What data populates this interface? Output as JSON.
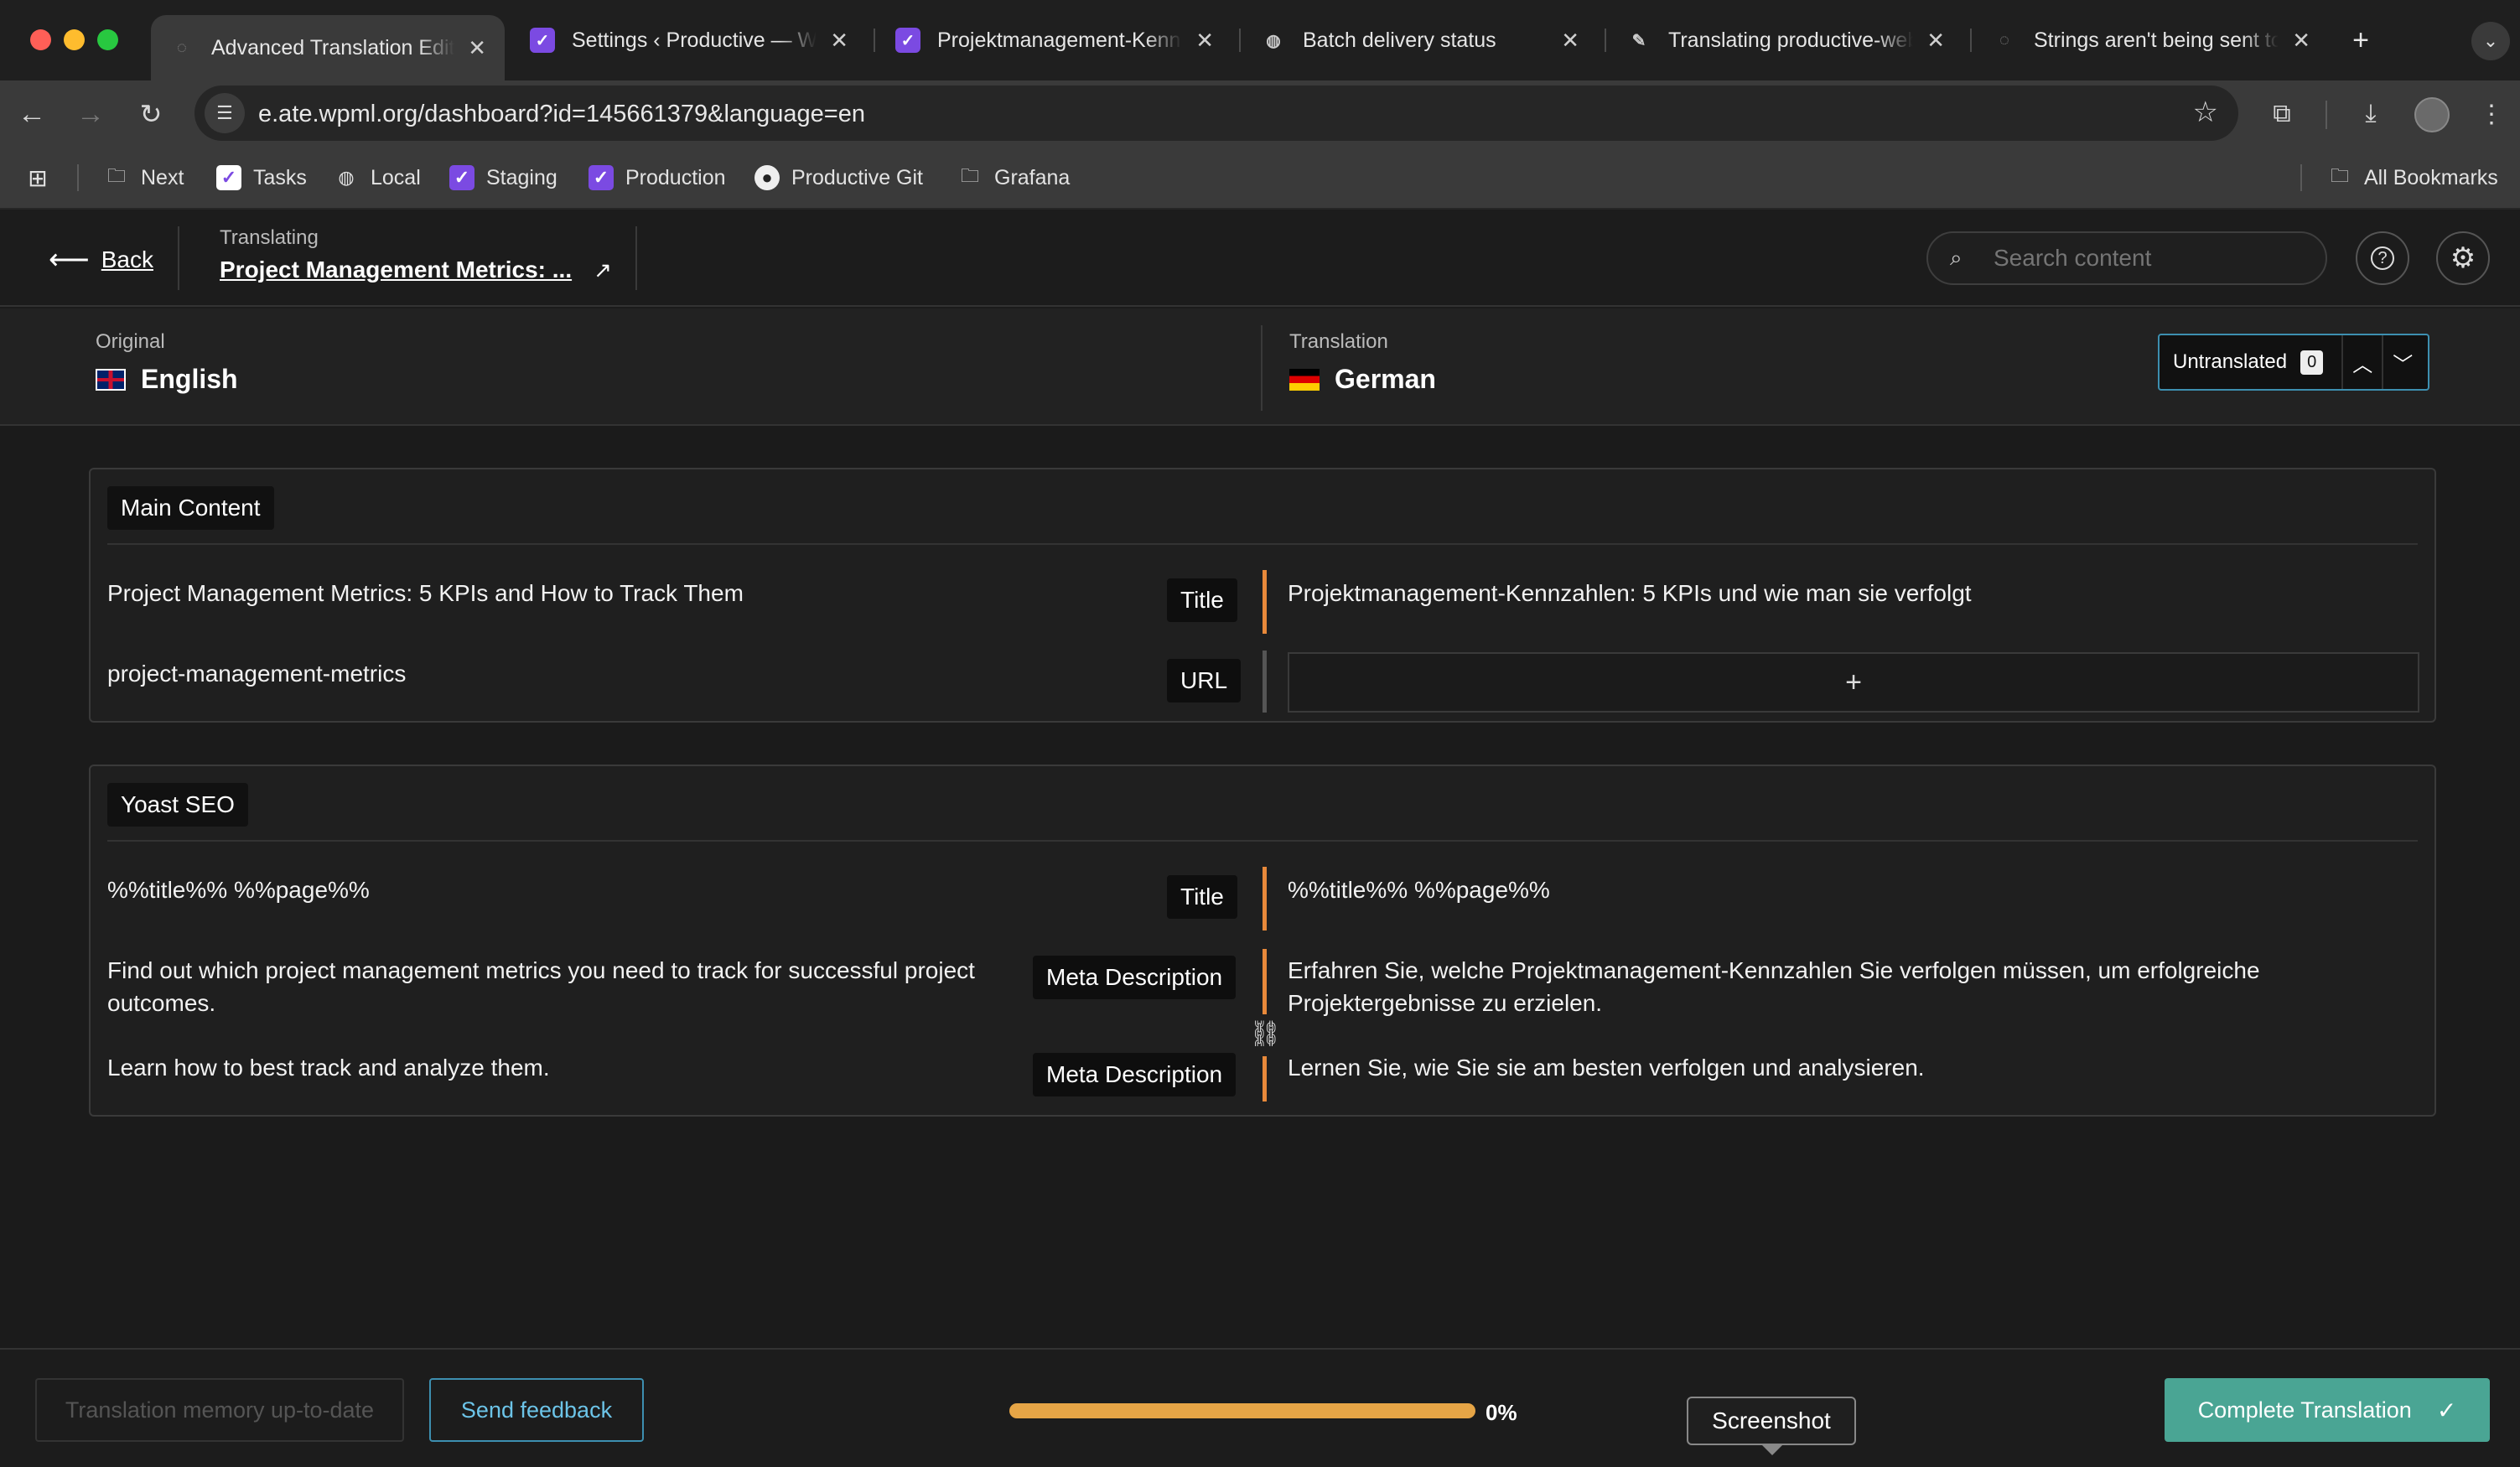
{
  "browser": {
    "tabs": [
      {
        "title": "Advanced Translation Editor",
        "icon": "loading-icon",
        "active": true
      },
      {
        "title": "Settings ‹ Productive — WordPress",
        "icon": "productive-icon",
        "active": false
      },
      {
        "title": "Projektmanagement-Kennzahlen",
        "icon": "productive-icon",
        "active": false
      },
      {
        "title": "Batch delivery status",
        "icon": "globe-icon",
        "active": false
      },
      {
        "title": "Translating productive-website",
        "icon": "feather-icon",
        "active": false
      },
      {
        "title": "Strings aren't being sent to translation",
        "icon": "loading-icon",
        "active": false
      }
    ],
    "new_tab": "+",
    "url": "e.ate.wpml.org/dashboard?id=145661379&language=en",
    "bookmarks": [
      {
        "label": "Next",
        "icon": "folder-icon"
      },
      {
        "label": "Tasks",
        "icon": "productive-icon"
      },
      {
        "label": "Local",
        "icon": "globe-icon"
      },
      {
        "label": "Staging",
        "icon": "productive-icon"
      },
      {
        "label": "Production",
        "icon": "productive-icon"
      },
      {
        "label": "Productive Git",
        "icon": "github-icon"
      },
      {
        "label": "Grafana",
        "icon": "folder-icon"
      }
    ],
    "all_bookmarks": "All Bookmarks"
  },
  "header": {
    "back_label": "Back",
    "translating_label": "Translating",
    "document_title": "Project Management Metrics: ...",
    "search_placeholder": "Search content"
  },
  "languages": {
    "original_label": "Original",
    "original_lang": "English",
    "translation_label": "Translation",
    "translation_lang": "German",
    "filter_label": "Untranslated",
    "filter_count": "0"
  },
  "sections": [
    {
      "label": "Main Content",
      "rows": [
        {
          "original": "Project Management Metrics: 5 KPIs and How to Track Them",
          "tag": "Title",
          "translation": "Projektmanagement-Kennzahlen: 5 KPIs und wie man sie verfolgt"
        },
        {
          "original": "project-management-metrics",
          "tag": "URL",
          "translation": ""
        }
      ]
    },
    {
      "label": "Yoast SEO",
      "rows": [
        {
          "original": "%%title%% %%page%%",
          "tag": "Title",
          "translation": "%%title%% %%page%%"
        },
        {
          "original": "Find out which project management metrics you need to track for successful project outcomes.",
          "tag": "Meta Description",
          "translation": "Erfahren Sie, welche Projektmanagement-Kennzahlen Sie verfolgen müssen, um erfolgreiche Projektergebnisse zu erzielen."
        },
        {
          "original": "Learn how to best track and analyze them.",
          "tag": "Meta Description",
          "translation": "Lernen Sie, wie Sie sie am besten verfolgen und analysieren."
        }
      ]
    }
  ],
  "footer": {
    "tm_label": "Translation memory up-to-date",
    "feedback_label": "Send feedback",
    "progress_percent": 0,
    "progress_text": "0%",
    "tooltip": "Screenshot",
    "complete_label": "Complete Translation"
  },
  "colors": {
    "accent_orange": "#e8893a",
    "complete_green": "#4aa594",
    "feedback_blue": "#6cc4e8"
  }
}
